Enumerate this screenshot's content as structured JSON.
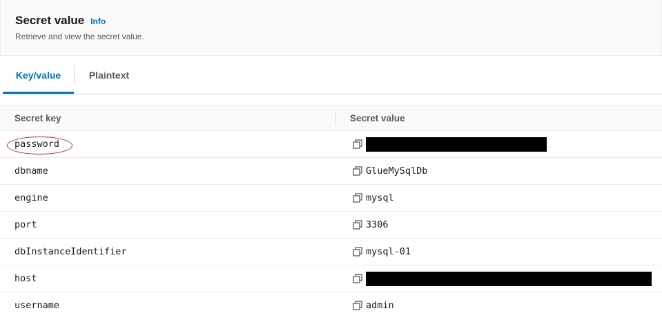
{
  "header": {
    "title": "Secret value",
    "info_label": "Info",
    "subtitle": "Retrieve and view the secret value."
  },
  "tabs": [
    {
      "label": "Key/value",
      "active": true
    },
    {
      "label": "Plaintext",
      "active": false
    }
  ],
  "table": {
    "columns": [
      "Secret key",
      "Secret value"
    ],
    "rows": [
      {
        "key": "password",
        "value": "",
        "redacted": true,
        "highlighted": true
      },
      {
        "key": "dbname",
        "value": "GlueMySqlDb",
        "redacted": false
      },
      {
        "key": "engine",
        "value": "mysql",
        "redacted": false
      },
      {
        "key": "port",
        "value": "3306",
        "redacted": false
      },
      {
        "key": "dbInstanceIdentifier",
        "value": "mysql-01",
        "redacted": false
      },
      {
        "key": "host",
        "value": "",
        "redacted": true
      },
      {
        "key": "username",
        "value": "admin",
        "redacted": false
      }
    ]
  },
  "colors": {
    "accent": "#0073bb",
    "annotation": "#b4262a",
    "redaction": "#000000"
  },
  "icons": {
    "copy": "copy-icon"
  }
}
